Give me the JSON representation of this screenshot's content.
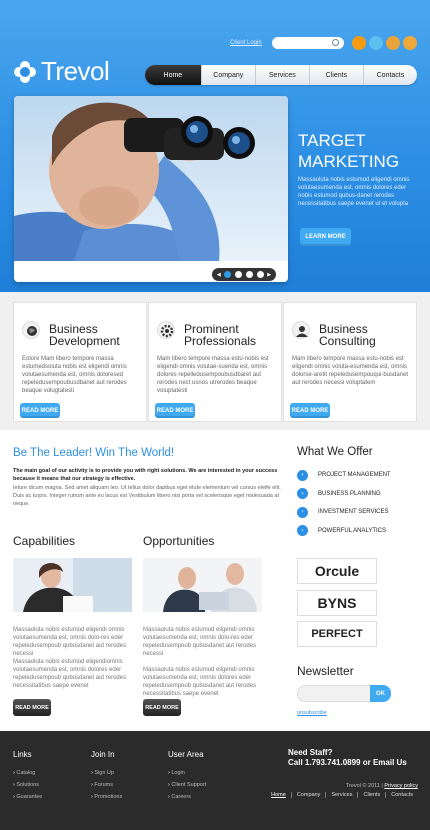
{
  "header": {
    "client_login": "Client Login",
    "logo_text": "Trevol",
    "nav": [
      "Home",
      "Company",
      "Services",
      "Clients",
      "Contacts"
    ]
  },
  "hero": {
    "title": "TARGET MARKETING",
    "text": "Massaoluta nobis estumod eligendi omnis volutaesumenda est, omnis dolores eder nobis estumod qubus-danet rerodes necessitatibus saepe evenet ut et volupta",
    "button": "LEARN MORE",
    "pager_active": 1
  },
  "features": [
    {
      "title": "Business Development",
      "text": "Eolore Mam libero tempore massa estumedsoluta nobis est eligendi omnis volutaesumenda est, omnis doloresed repeledusempoubusdbanet aut rerodes beaque volugtatesti",
      "button": "READ MORE"
    },
    {
      "title": "Prominent Professionals",
      "text": "Mam libero tempore massa estu-nobis est eligendi omnis volutae-suenda est, omnis dolores repelledusempoubusdbaret aut rerodes nect usnos utrerodes beaque voluptatesti",
      "button": "READ MORE"
    },
    {
      "title": "Business Consulting",
      "text": "Mam libero tempore massa estu-nobis est eligendi omnis voluta-esumenda est, omnis dolorse-aretit repeledusempouqui-busdanet aut rerodes necessi voluptatem",
      "button": "READ MORE"
    }
  ],
  "leader": {
    "title": "Be The Leader! Win The World!",
    "strong": "The main goal of our activity is to provide you with right solutions. We are interested in your success because it means that our strategy is effective.",
    "text": "Ieture dicum magna. Sed amet aliquam leo. Ut tellus dolor dapibus eget elute elementum vel cursus eleife elit. Duis ac turpis. Integer rutrum ante eu lacus est Vestibulum libero nisi porta vel scelerisque eget malesuada at neque."
  },
  "offer": {
    "title": "What We Offer",
    "items": [
      "PROJECT MANAGEMENT",
      "BUSINESS PLANNING",
      "INVESTMENT SERVICES",
      "POWERFUL ANALYTICS"
    ]
  },
  "capabilities": {
    "title": "Capabilities",
    "p1": "Massaoluta nobis estumod eligendi omnis volutaesumenda est, omnis dolo-res eder repeledusempoub qubusdanet aut rerodes necessi",
    "p2": "Massaoluta nobis estumod eligendiomnis volutaesumenda est, omnis dolores eder repeledusempoub qubusdanet aut rerodes necessitatibus saepe evenet",
    "button": "READ MORE"
  },
  "opportunities": {
    "title": "Opportunities",
    "p1": "Massaoluta nobis estumod eligendi omnis volutaesumenda est, omnis dolo-res eder repeledusempoub qubusdanet aut rerodes necessi",
    "p2": "Massaoluta nobis estumod eligendi omnis volutaesumenda est, omnis dolores eder repeledusempoub qubusdanet aut rerodes necessitatibus saepe evenet",
    "button": "READ MORE"
  },
  "partners": [
    "Orcule",
    "BYNS",
    "PERFECT"
  ],
  "newsletter": {
    "title": "Newsletter",
    "button": "OK",
    "unsubscribe": "unsubscribe"
  },
  "footer": {
    "links": {
      "title": "Links",
      "items": [
        "Catalog",
        "Solutions",
        "Guarantee"
      ]
    },
    "join": {
      "title": "Join In",
      "items": [
        "Sign Up",
        "Forums",
        "Promotions"
      ]
    },
    "user": {
      "title": "User Area",
      "items": [
        "Login",
        "Client Support",
        "Careers"
      ]
    },
    "need_staff": "Need Staff?",
    "phone": "Call 1.793.741.0899 or Email Us",
    "copyright": "Trevol © 2011 |",
    "privacy": "Privacy policy",
    "nav": [
      "Home",
      "Company",
      "Services",
      "Clients",
      "Contacts"
    ]
  },
  "colors": {
    "accent": "#2d8fe4",
    "button": "#3fa9f2",
    "footer": "#2b2b2b"
  }
}
